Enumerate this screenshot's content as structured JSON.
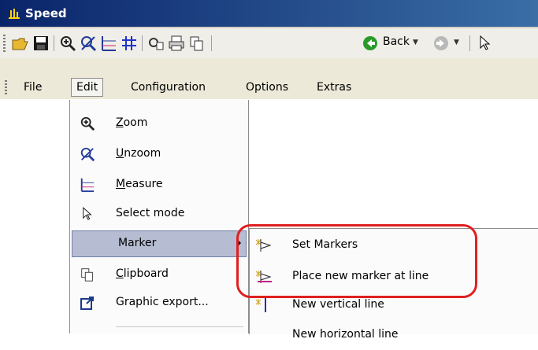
{
  "window": {
    "title": "Speed"
  },
  "toolbar": {
    "back_label": "Back"
  },
  "menubar": {
    "items": [
      "File",
      "Edit",
      "Configuration",
      "Options",
      "Extras"
    ]
  },
  "edit_menu": {
    "items": [
      {
        "label": "Zoom",
        "underline": "Z",
        "rest": "oom",
        "icon": "zoom-icon"
      },
      {
        "label": "Unzoom",
        "underline": "U",
        "rest": "nzoom",
        "icon": "unzoom-icon"
      },
      {
        "label": "Measure",
        "underline": "M",
        "rest": "easure",
        "icon": "measure-icon"
      },
      {
        "label": "Select mode",
        "icon": "cursor-icon"
      },
      {
        "label": "Marker",
        "icon": "",
        "submenu": true
      },
      {
        "label": "Clipboard",
        "underline": "C",
        "rest": "lipboard",
        "icon": "clipboard-icon"
      },
      {
        "label": "Graphic export...",
        "icon": "export-icon"
      }
    ]
  },
  "marker_submenu": {
    "items": [
      {
        "label": "Set Markers",
        "icon": "set-markers-icon"
      },
      {
        "label": "Place new marker at line",
        "icon": "place-marker-icon"
      },
      {
        "label": "New vertical line",
        "icon": "vertical-line-icon"
      },
      {
        "label": "New horizontal line",
        "icon": "horizontal-line-icon"
      }
    ]
  },
  "colors": {
    "title_start": "#0a246a",
    "title_end": "#3a6ea5",
    "highlight": "#e02020",
    "menu_highlight": "#b6bdd2"
  }
}
